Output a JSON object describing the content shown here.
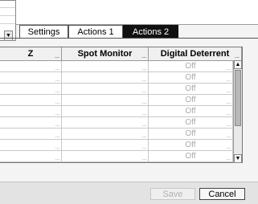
{
  "popup": {
    "button_label": "cel",
    "scroll_arrow": "▼"
  },
  "tabs": [
    {
      "label": "Settings",
      "active": false
    },
    {
      "label": "Actions 1",
      "active": false
    },
    {
      "label": "Actions 2",
      "active": true
    }
  ],
  "table": {
    "headers": [
      "Z",
      "Spot Monitor",
      "Digital Deterrent"
    ],
    "header_menu": "...",
    "rows": [
      [
        "",
        "",
        "Off"
      ],
      [
        "",
        "",
        "Off"
      ],
      [
        "",
        "",
        "Off"
      ],
      [
        "",
        "",
        "Off"
      ],
      [
        "",
        "",
        "Off"
      ],
      [
        "",
        "",
        "Off"
      ],
      [
        "",
        "",
        "Off"
      ],
      [
        "",
        "",
        "Off"
      ],
      [
        "",
        "",
        "Off"
      ]
    ],
    "cell_menu": "..."
  },
  "scrollbar": {
    "up": "▲",
    "down": "▼"
  },
  "footer": {
    "save_label": "Save",
    "cancel_label": "Cancel"
  }
}
